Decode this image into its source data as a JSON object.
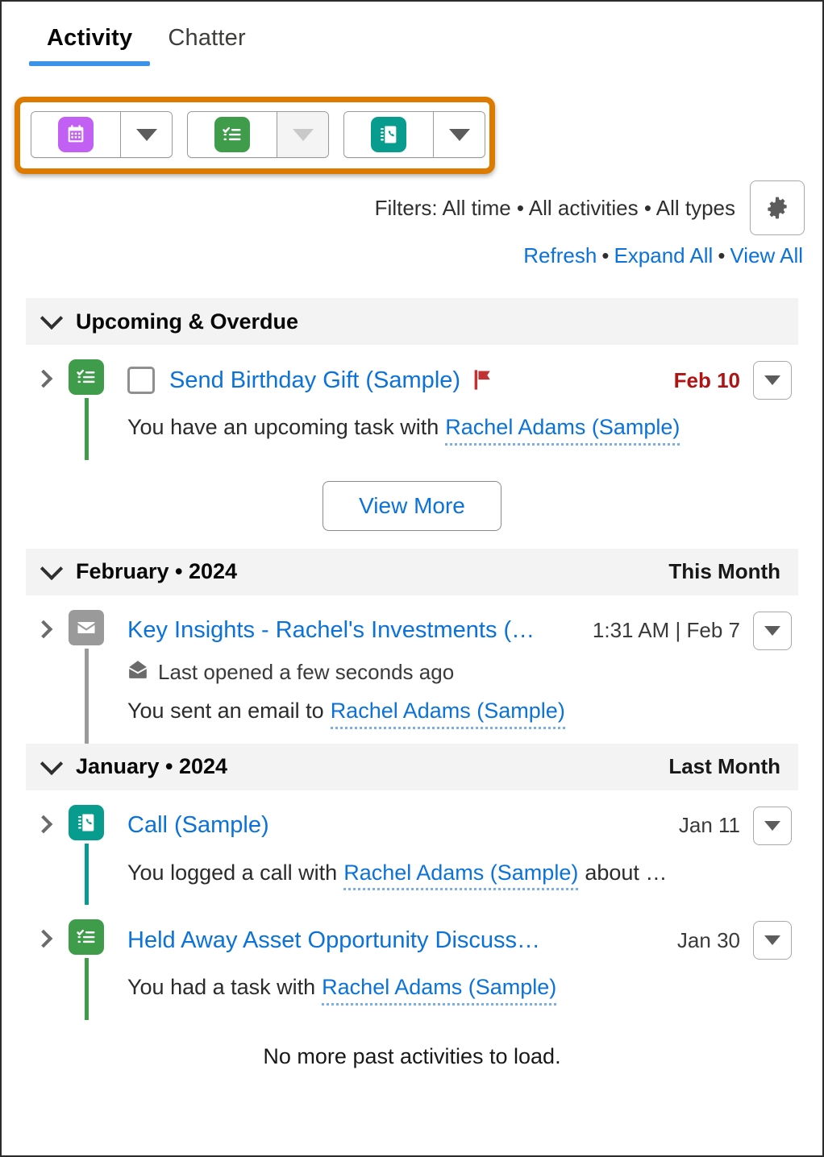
{
  "tabs": [
    {
      "label": "Activity",
      "active": true
    },
    {
      "label": "Chatter",
      "active": false
    }
  ],
  "action_bar": {
    "buttons": [
      {
        "icon": "calendar-event-icon",
        "color": "#c160f2",
        "dropdown_enabled": true
      },
      {
        "icon": "task-checklist-icon",
        "color": "#3f9c4a",
        "dropdown_enabled": false
      },
      {
        "icon": "log-a-call-icon",
        "color": "#089c8e",
        "dropdown_enabled": true
      }
    ],
    "highlight_color": "#dd7b00"
  },
  "filters": {
    "label": "Filters: All time • All activities • All types",
    "settings_icon": "gear-icon"
  },
  "links": {
    "refresh": "Refresh",
    "expand_all": "Expand All",
    "view_all": "View All",
    "separator": "•"
  },
  "sections": [
    {
      "title": "Upcoming & Overdue",
      "badge": "",
      "items": [
        {
          "icon": "task-checklist-icon",
          "icon_color": "#3f9c4a",
          "connector_color": "green",
          "has_checkbox": true,
          "checked": false,
          "title": "Send Birthday Gift (Sample)",
          "flag": "red-flag-icon",
          "date": "Feb 10",
          "overdue": true,
          "desc_prefix": "You have an upcoming task with",
          "contact": "Rachel Adams (Sample)",
          "desc_suffix": ""
        }
      ],
      "view_more": "View More"
    },
    {
      "title": "February • 2024",
      "badge": "This Month",
      "items": [
        {
          "icon": "email-icon",
          "icon_color": "#9a9a9a",
          "connector_color": "gray",
          "has_checkbox": false,
          "title": "Key Insights - Rachel's Investments (…",
          "date": "1:31 AM | Feb 7",
          "overdue": false,
          "meta_icon": "opened-envelope-icon",
          "meta": "Last opened a few seconds ago",
          "desc_prefix": "You sent an email to",
          "contact": "Rachel Adams (Sample)",
          "desc_suffix": ""
        }
      ]
    },
    {
      "title": "January • 2024",
      "badge": "Last Month",
      "items": [
        {
          "icon": "log-a-call-icon",
          "icon_color": "#089c8e",
          "connector_color": "teal",
          "has_checkbox": false,
          "title": "Call (Sample)",
          "date": "Jan 11",
          "overdue": false,
          "desc_prefix": "You logged a call with",
          "contact": "Rachel Adams (Sample)",
          "desc_suffix": "about …"
        },
        {
          "icon": "task-checklist-icon",
          "icon_color": "#3f9c4a",
          "connector_color": "green",
          "has_checkbox": false,
          "title": "Held Away Asset Opportunity Discuss…",
          "date": "Jan 30",
          "overdue": false,
          "desc_prefix": "You had a task with",
          "contact": "Rachel Adams (Sample)",
          "desc_suffix": ""
        }
      ]
    }
  ],
  "footer": {
    "note": "No more past activities to load."
  }
}
